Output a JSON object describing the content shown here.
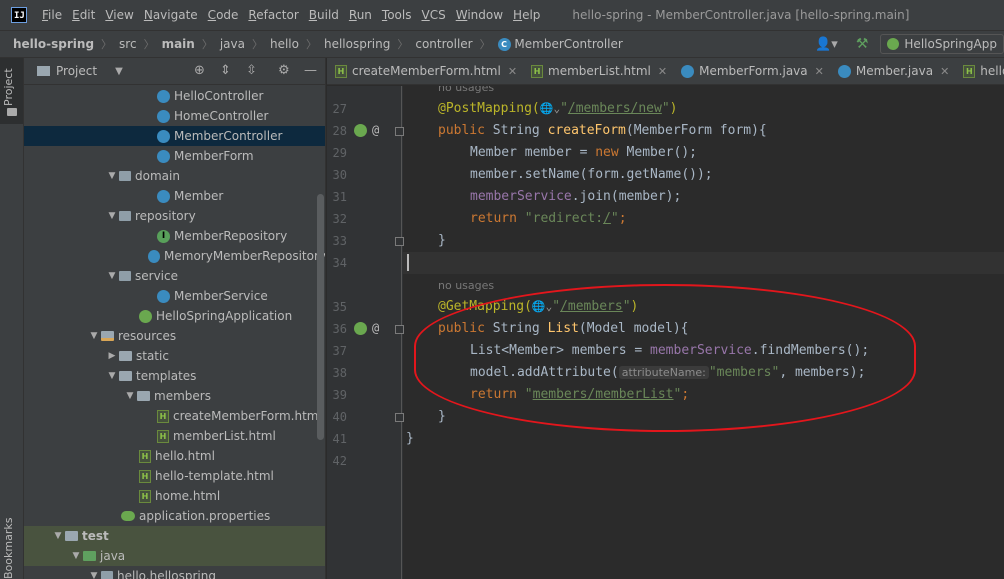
{
  "app": {
    "logo_text": "IJ",
    "window_title": "hello-spring - MemberController.java [hello-spring.main]"
  },
  "menu": [
    "File",
    "Edit",
    "View",
    "Navigate",
    "Code",
    "Refactor",
    "Build",
    "Run",
    "Tools",
    "VCS",
    "Window",
    "Help"
  ],
  "breadcrumb": [
    "hello-spring",
    "src",
    "main",
    "java",
    "hello",
    "hellospring",
    "controller",
    "MemberController"
  ],
  "toolbar": {
    "run_config": "HelloSpringApp",
    "icons": [
      "user-icon",
      "build-hammer-icon",
      "spring-run-icon"
    ]
  },
  "tool_stripe": {
    "project_label": "Project",
    "bookmarks_label": "Bookmarks"
  },
  "project_panel": {
    "title": "Project",
    "tree": [
      {
        "label": "HelloController",
        "icon": "class",
        "indent": 133,
        "arrow": ""
      },
      {
        "label": "HomeController",
        "icon": "class",
        "indent": 133,
        "arrow": ""
      },
      {
        "label": "MemberController",
        "icon": "class",
        "indent": 133,
        "arrow": "",
        "selected": true
      },
      {
        "label": "MemberForm",
        "icon": "class",
        "indent": 133,
        "arrow": ""
      },
      {
        "label": "domain",
        "icon": "pkg",
        "indent": 95,
        "arrow": "v"
      },
      {
        "label": "Member",
        "icon": "class",
        "indent": 133,
        "arrow": ""
      },
      {
        "label": "repository",
        "icon": "pkg",
        "indent": 95,
        "arrow": "v"
      },
      {
        "label": "MemberRepository",
        "icon": "iface",
        "indent": 133,
        "arrow": ""
      },
      {
        "label": "MemoryMemberRepository",
        "icon": "class",
        "indent": 133,
        "arrow": ""
      },
      {
        "label": "service",
        "icon": "pkg",
        "indent": 95,
        "arrow": "v"
      },
      {
        "label": "MemberService",
        "icon": "class",
        "indent": 133,
        "arrow": ""
      },
      {
        "label": "HelloSpringApplication",
        "icon": "spring",
        "indent": 115,
        "arrow": ""
      },
      {
        "label": "resources",
        "icon": "res",
        "indent": 77,
        "arrow": "v"
      },
      {
        "label": "static",
        "icon": "folder",
        "indent": 95,
        "arrow": ">"
      },
      {
        "label": "templates",
        "icon": "folder",
        "indent": 95,
        "arrow": "v"
      },
      {
        "label": "members",
        "icon": "folder",
        "indent": 113,
        "arrow": "v"
      },
      {
        "label": "createMemberForm.html",
        "icon": "html",
        "indent": 133,
        "arrow": ""
      },
      {
        "label": "memberList.html",
        "icon": "html",
        "indent": 133,
        "arrow": ""
      },
      {
        "label": "hello.html",
        "icon": "html",
        "indent": 115,
        "arrow": ""
      },
      {
        "label": "hello-template.html",
        "icon": "html",
        "indent": 115,
        "arrow": ""
      },
      {
        "label": "home.html",
        "icon": "html",
        "indent": 115,
        "arrow": ""
      },
      {
        "label": "application.properties",
        "icon": "props",
        "indent": 97,
        "arrow": ""
      },
      {
        "label": "test",
        "icon": "folder",
        "indent": 41,
        "arrow": "v",
        "bold": true,
        "test": true
      },
      {
        "label": "java",
        "icon": "test-folder",
        "indent": 59,
        "arrow": "v",
        "test": true
      },
      {
        "label": "hello.hellospring",
        "icon": "pkg",
        "indent": 77,
        "arrow": "v"
      }
    ]
  },
  "tabs": [
    {
      "label": "createMemberForm.html",
      "icon": "html"
    },
    {
      "label": "memberList.html",
      "icon": "html"
    },
    {
      "label": "MemberForm.java",
      "icon": "class"
    },
    {
      "label": "Member.java",
      "icon": "class"
    },
    {
      "label": "hello.html",
      "icon": "html"
    }
  ],
  "editor": {
    "usage_hints": [
      "no usages",
      "no usages"
    ],
    "line_numbers": [
      "27",
      "28",
      "29",
      "30",
      "31",
      "32",
      "33",
      "34",
      "35",
      "36",
      "37",
      "38",
      "39",
      "40",
      "41",
      "42"
    ],
    "code": {
      "l27": {
        "ann": "@PostMapping(",
        "url": "/members/new",
        "close": ")"
      },
      "l28": {
        "kw": "public ",
        "type": "String ",
        "method": "createForm",
        "rest": "(MemberForm form){"
      },
      "l29": {
        "a": "Member member = ",
        "kw": "new ",
        "b": "Member();"
      },
      "l30": {
        "a": "member.setName(form.getName());"
      },
      "l31": {
        "field": "memberService",
        "a": ".join(member);"
      },
      "l32": {
        "kw": "return ",
        "str_open": "\"redirect:",
        "url": "/",
        "str_close": "\"",
        "end": ";"
      },
      "l33": {
        "a": "}"
      },
      "l35": {
        "ann": "@GetMapping(",
        "url": "/members",
        "close": ")"
      },
      "l36": {
        "kw": "public ",
        "type": "String ",
        "method": "List",
        "rest": "(Model model){"
      },
      "l37": {
        "a": "List<Member> members = ",
        "field": "memberService",
        "b": ".findMembers();"
      },
      "l38": {
        "a": "model.addAttribute(",
        "inlay": "attributeName:",
        "str": "\"members\"",
        "b": ", members);"
      },
      "l39": {
        "kw": "return ",
        "str_open": "\"",
        "url": "members/memberList",
        "str_close": "\"",
        "end": ";"
      },
      "l40": {
        "a": "}"
      },
      "l41": {
        "a": "}"
      }
    }
  },
  "annotation": {
    "color": "#e3161c",
    "shape": "ellipse",
    "target": "GetMapping list method (lines 35-40)"
  }
}
